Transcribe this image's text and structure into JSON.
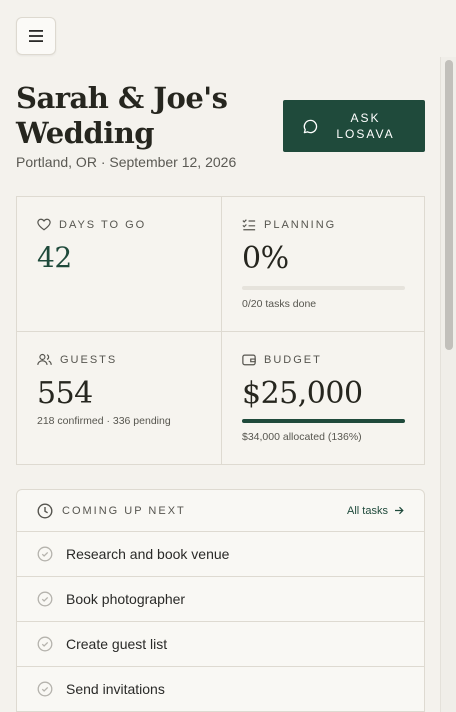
{
  "header": {
    "title": "Sarah & Joe's Wedding",
    "subtitle": "Portland, OR · September 12, 2026",
    "ask_label": "ASK\nLOSAVA"
  },
  "stats": {
    "days": {
      "label": "DAYS TO GO",
      "value": "42"
    },
    "planning": {
      "label": "PLANNING",
      "value": "0%",
      "progress": 0,
      "note": "0/20 tasks done"
    },
    "guests": {
      "label": "GUESTS",
      "value": "554",
      "note": "218 confirmed · 336 pending"
    },
    "budget": {
      "label": "BUDGET",
      "value": "$25,000",
      "progress": 1.0,
      "note": "$34,000 allocated (136%)"
    }
  },
  "upcoming": {
    "title": "COMING UP NEXT",
    "link_label": "All tasks",
    "tasks": [
      {
        "label": "Research and book venue"
      },
      {
        "label": "Book photographer"
      },
      {
        "label": "Create guest list"
      },
      {
        "label": "Send invitations"
      }
    ]
  },
  "colors": {
    "accent": "#1f4a3b",
    "background": "#f4f2ed"
  }
}
